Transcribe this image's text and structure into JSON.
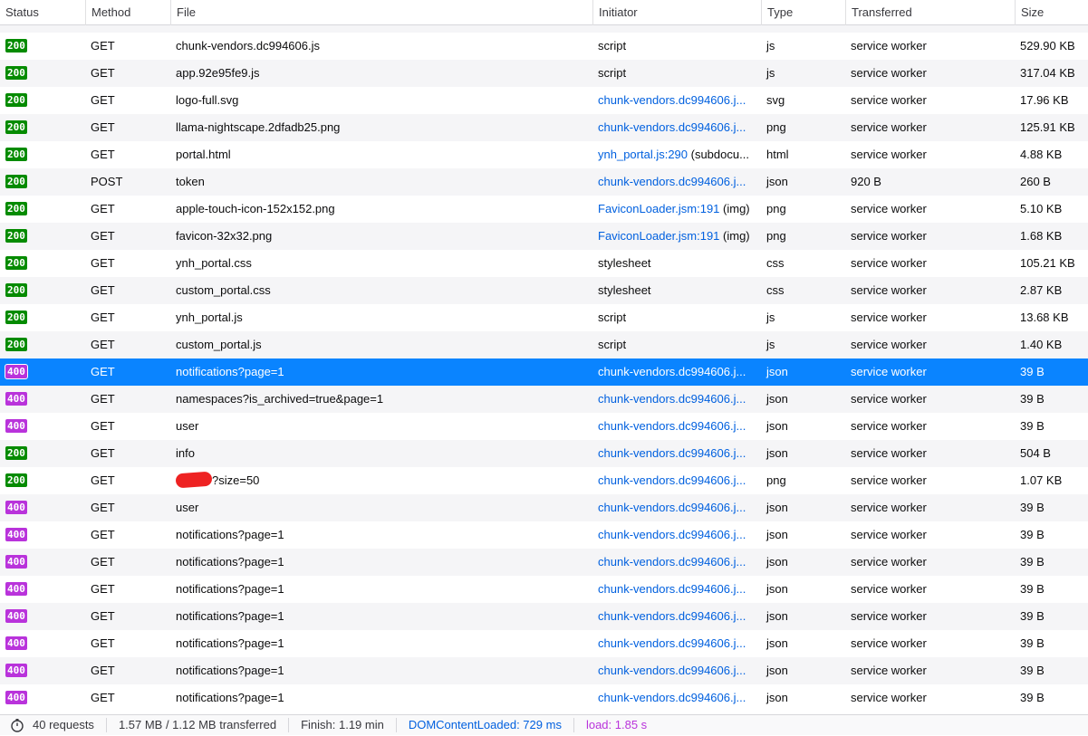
{
  "columns": {
    "status": "Status",
    "method": "Method",
    "file": "File",
    "initiator": "Initiator",
    "type": "Type",
    "transferred": "Transferred",
    "size": "Size"
  },
  "rows": [
    {
      "status": "200",
      "method": "GET",
      "file": "chunk-vendors.dc994606.js",
      "initiator": "script",
      "initiator_suffix": "",
      "initiator_link": false,
      "type": "js",
      "transferred": "service worker",
      "size": "529.90 KB"
    },
    {
      "status": "200",
      "method": "GET",
      "file": "app.92e95fe9.js",
      "initiator": "script",
      "initiator_suffix": "",
      "initiator_link": false,
      "type": "js",
      "transferred": "service worker",
      "size": "317.04 KB"
    },
    {
      "status": "200",
      "method": "GET",
      "file": "logo-full.svg",
      "initiator": "chunk-vendors.dc994606.j...",
      "initiator_suffix": "",
      "initiator_link": true,
      "type": "svg",
      "transferred": "service worker",
      "size": "17.96 KB"
    },
    {
      "status": "200",
      "method": "GET",
      "file": "llama-nightscape.2dfadb25.png",
      "initiator": "chunk-vendors.dc994606.j...",
      "initiator_suffix": "",
      "initiator_link": true,
      "type": "png",
      "transferred": "service worker",
      "size": "125.91 KB"
    },
    {
      "status": "200",
      "method": "GET",
      "file": "portal.html",
      "initiator": "ynh_portal.js:290",
      "initiator_suffix": " (subdocu...",
      "initiator_link": true,
      "type": "html",
      "transferred": "service worker",
      "size": "4.88 KB"
    },
    {
      "status": "200",
      "method": "POST",
      "file": "token",
      "initiator": "chunk-vendors.dc994606.j...",
      "initiator_suffix": "",
      "initiator_link": true,
      "type": "json",
      "transferred": "920 B",
      "size": "260 B"
    },
    {
      "status": "200",
      "method": "GET",
      "file": "apple-touch-icon-152x152.png",
      "initiator": "FaviconLoader.jsm:191",
      "initiator_suffix": " (img)",
      "initiator_link": true,
      "type": "png",
      "transferred": "service worker",
      "size": "5.10 KB"
    },
    {
      "status": "200",
      "method": "GET",
      "file": "favicon-32x32.png",
      "initiator": "FaviconLoader.jsm:191",
      "initiator_suffix": " (img)",
      "initiator_link": true,
      "type": "png",
      "transferred": "service worker",
      "size": "1.68 KB"
    },
    {
      "status": "200",
      "method": "GET",
      "file": "ynh_portal.css",
      "initiator": "stylesheet",
      "initiator_suffix": "",
      "initiator_link": false,
      "type": "css",
      "transferred": "service worker",
      "size": "105.21 KB"
    },
    {
      "status": "200",
      "method": "GET",
      "file": "custom_portal.css",
      "initiator": "stylesheet",
      "initiator_suffix": "",
      "initiator_link": false,
      "type": "css",
      "transferred": "service worker",
      "size": "2.87 KB"
    },
    {
      "status": "200",
      "method": "GET",
      "file": "ynh_portal.js",
      "initiator": "script",
      "initiator_suffix": "",
      "initiator_link": false,
      "type": "js",
      "transferred": "service worker",
      "size": "13.68 KB"
    },
    {
      "status": "200",
      "method": "GET",
      "file": "custom_portal.js",
      "initiator": "script",
      "initiator_suffix": "",
      "initiator_link": false,
      "type": "js",
      "transferred": "service worker",
      "size": "1.40 KB"
    },
    {
      "status": "400",
      "method": "GET",
      "file": "notifications?page=1",
      "initiator": "chunk-vendors.dc994606.j...",
      "initiator_suffix": "",
      "initiator_link": true,
      "type": "json",
      "transferred": "service worker",
      "size": "39 B",
      "selected": true
    },
    {
      "status": "400",
      "method": "GET",
      "file": "namespaces?is_archived=true&page=1",
      "initiator": "chunk-vendors.dc994606.j...",
      "initiator_suffix": "",
      "initiator_link": true,
      "type": "json",
      "transferred": "service worker",
      "size": "39 B"
    },
    {
      "status": "400",
      "method": "GET",
      "file": "user",
      "initiator": "chunk-vendors.dc994606.j...",
      "initiator_suffix": "",
      "initiator_link": true,
      "type": "json",
      "transferred": "service worker",
      "size": "39 B"
    },
    {
      "status": "200",
      "method": "GET",
      "file": "info",
      "initiator": "chunk-vendors.dc994606.j...",
      "initiator_suffix": "",
      "initiator_link": true,
      "type": "json",
      "transferred": "service worker",
      "size": "504 B"
    },
    {
      "status": "200",
      "method": "GET",
      "file": "?size=50",
      "redacted": true,
      "initiator": "chunk-vendors.dc994606.j...",
      "initiator_suffix": "",
      "initiator_link": true,
      "type": "png",
      "transferred": "service worker",
      "size": "1.07 KB"
    },
    {
      "status": "400",
      "method": "GET",
      "file": "user",
      "initiator": "chunk-vendors.dc994606.j...",
      "initiator_suffix": "",
      "initiator_link": true,
      "type": "json",
      "transferred": "service worker",
      "size": "39 B"
    },
    {
      "status": "400",
      "method": "GET",
      "file": "notifications?page=1",
      "initiator": "chunk-vendors.dc994606.j...",
      "initiator_suffix": "",
      "initiator_link": true,
      "type": "json",
      "transferred": "service worker",
      "size": "39 B"
    },
    {
      "status": "400",
      "method": "GET",
      "file": "notifications?page=1",
      "initiator": "chunk-vendors.dc994606.j...",
      "initiator_suffix": "",
      "initiator_link": true,
      "type": "json",
      "transferred": "service worker",
      "size": "39 B"
    },
    {
      "status": "400",
      "method": "GET",
      "file": "notifications?page=1",
      "initiator": "chunk-vendors.dc994606.j...",
      "initiator_suffix": "",
      "initiator_link": true,
      "type": "json",
      "transferred": "service worker",
      "size": "39 B"
    },
    {
      "status": "400",
      "method": "GET",
      "file": "notifications?page=1",
      "initiator": "chunk-vendors.dc994606.j...",
      "initiator_suffix": "",
      "initiator_link": true,
      "type": "json",
      "transferred": "service worker",
      "size": "39 B"
    },
    {
      "status": "400",
      "method": "GET",
      "file": "notifications?page=1",
      "initiator": "chunk-vendors.dc994606.j...",
      "initiator_suffix": "",
      "initiator_link": true,
      "type": "json",
      "transferred": "service worker",
      "size": "39 B"
    },
    {
      "status": "400",
      "method": "GET",
      "file": "notifications?page=1",
      "initiator": "chunk-vendors.dc994606.j...",
      "initiator_suffix": "",
      "initiator_link": true,
      "type": "json",
      "transferred": "service worker",
      "size": "39 B"
    },
    {
      "status": "400",
      "method": "GET",
      "file": "notifications?page=1",
      "initiator": "chunk-vendors.dc994606.j...",
      "initiator_suffix": "",
      "initiator_link": true,
      "type": "json",
      "transferred": "service worker",
      "size": "39 B"
    }
  ],
  "footer": {
    "icon": "stopwatch-icon",
    "requests": "40 requests",
    "transferred": "1.57 MB / 1.12 MB transferred",
    "finish": "Finish: 1.19 min",
    "dom_content_loaded": "DOMContentLoaded: 729 ms",
    "load": "load: 1.85 s"
  },
  "colors": {
    "status_ok": "#058b00",
    "status_client_error": "#b933db",
    "selection": "#0a84ff",
    "link": "#0060df"
  }
}
